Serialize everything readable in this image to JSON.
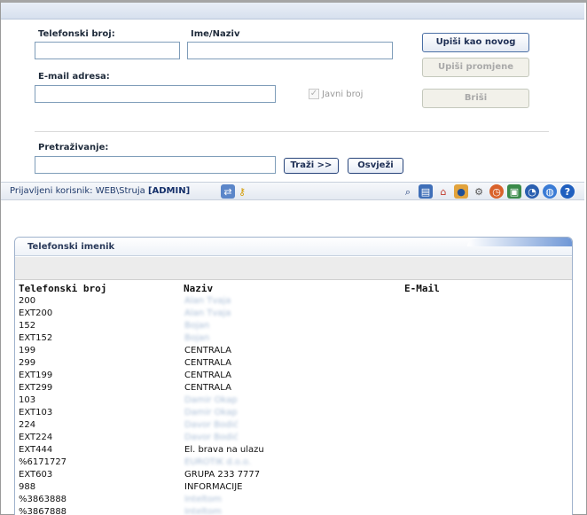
{
  "form": {
    "phone_label": "Telefonski broj:",
    "name_label": "Ime/Naziv",
    "email_label": "E-mail adresa:",
    "phone_value": "",
    "name_value": "",
    "email_value": "",
    "public_label": "Javni broj",
    "search_label": "Pretraživanje:",
    "search_value": "",
    "add_button": "Upiši kao novog",
    "save_button": "Upiši promjene",
    "delete_button": "Briši",
    "search_button": "Traži >>",
    "refresh_button": "Osvježi"
  },
  "status": {
    "prefix": "Prijavljeni korisnik: ",
    "user": "WEB\\Struja",
    "role": "[ADMIN]"
  },
  "toolbar_icons": [
    "users-key-icon",
    "key-icon",
    "search-icon",
    "book-icon",
    "home-icon",
    "group-icon",
    "gear-icon",
    "clock-icon",
    "window-icon",
    "disk-icon",
    "globe-icon",
    "help-icon"
  ],
  "panel": {
    "title": "Telefonski imenik",
    "col_phone": "Telefonski broj",
    "col_name": "Naziv",
    "col_email": "E-Mail"
  },
  "rows": [
    {
      "phone": "200",
      "name": "Alan Tvaja",
      "blur": true
    },
    {
      "phone": "EXT200",
      "name": "Alan Tvaja",
      "blur": true
    },
    {
      "phone": "152",
      "name": "Bojan",
      "blur": true
    },
    {
      "phone": "EXT152",
      "name": "Bojan",
      "blur": true
    },
    {
      "phone": "199",
      "name": "CENTRALA",
      "blur": false
    },
    {
      "phone": "299",
      "name": "CENTRALA",
      "blur": false
    },
    {
      "phone": "EXT199",
      "name": "CENTRALA",
      "blur": false
    },
    {
      "phone": "EXT299",
      "name": "CENTRALA",
      "blur": false
    },
    {
      "phone": "103",
      "name": "Damir Okap",
      "blur": true
    },
    {
      "phone": "EXT103",
      "name": "Damir Okap",
      "blur": true
    },
    {
      "phone": "224",
      "name": "Davor Bodić",
      "blur": true
    },
    {
      "phone": "EXT224",
      "name": "Davor Bodić",
      "blur": true
    },
    {
      "phone": "EXT444",
      "name": "El. brava na ulazu",
      "blur": false
    },
    {
      "phone": "%6171727",
      "name": "EUROTIK d.o.o.",
      "blur": true
    },
    {
      "phone": "EXT603",
      "name": "GRUPA 233 7777",
      "blur": false
    },
    {
      "phone": "988",
      "name": "INFORMACIJE",
      "blur": false
    },
    {
      "phone": "%3863888",
      "name": "Inteltom",
      "blur": true
    },
    {
      "phone": "%3867888",
      "name": "Inteltom",
      "blur": true
    }
  ]
}
